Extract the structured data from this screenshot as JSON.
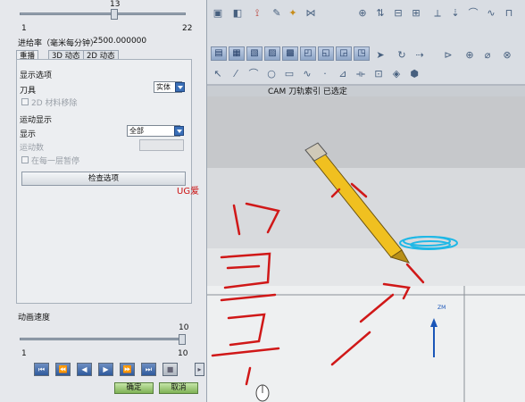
{
  "dialog": {
    "top_slider_value": "13",
    "top_slider_min": "1",
    "top_slider_max": "22",
    "top_slider_level": 0.57,
    "feed_rate_label": "进给率（毫米每分钟）",
    "feed_rate_value": "2500.000000",
    "tabs": [
      "重播",
      "3D 动态",
      "2D 动态"
    ],
    "display_options_heading": "显示选项",
    "tool_label": "刀具",
    "tool_value": "实体",
    "material_removal_2d": "2D 材料移除",
    "motion_display_heading": "运动显示",
    "display_label": "显示",
    "display_value": "全部",
    "motion_count_label": "运动数",
    "pause_each_label": "在每一层暂停",
    "check_options_button": "检查选项",
    "animation_speed_label": "动画速度",
    "anim_min": "1",
    "anim_max": "10",
    "anim_current": "10",
    "anim_level": 1.0,
    "playback_icons": [
      "skip-start",
      "step-back",
      "play-back",
      "play",
      "step-forward",
      "skip-end",
      "stop"
    ],
    "ok_button": "确定",
    "cancel_button": "取消"
  },
  "viewport": {
    "title": "CAM 刀轨索引 已选定",
    "annotation_text": "UG爱"
  },
  "colors": {
    "accent_blue": "#2f5a9c",
    "annotation_red": "#d01818",
    "tool_yellow": "#f0c020",
    "ok_green": "#7fb255"
  }
}
